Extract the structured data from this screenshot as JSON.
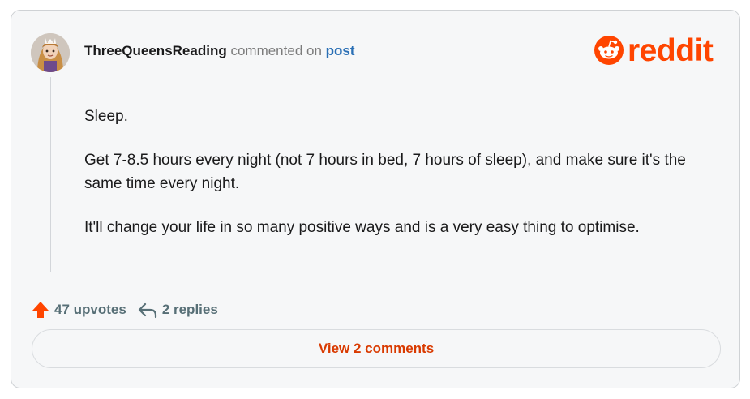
{
  "comment": {
    "username": "ThreeQueensReading",
    "action_text": "commented on",
    "post_link_label": "post",
    "paragraphs": [
      "Sleep.",
      "Get 7-8.5 hours every night (not 7 hours in bed, 7 hours of sleep), and make sure it's the same time every night.",
      "It'll change your life in so many positive ways and is a very easy thing to optimise."
    ]
  },
  "brand": {
    "name": "reddit",
    "color": "#ff4500"
  },
  "footer": {
    "upvotes_label": "47 upvotes",
    "replies_label": "2 replies",
    "view_comments_label": "View 2 comments"
  },
  "icons": {
    "upvote": "upvote-arrow-icon",
    "reply": "reply-arrow-icon",
    "logo": "reddit-snoo-icon"
  }
}
